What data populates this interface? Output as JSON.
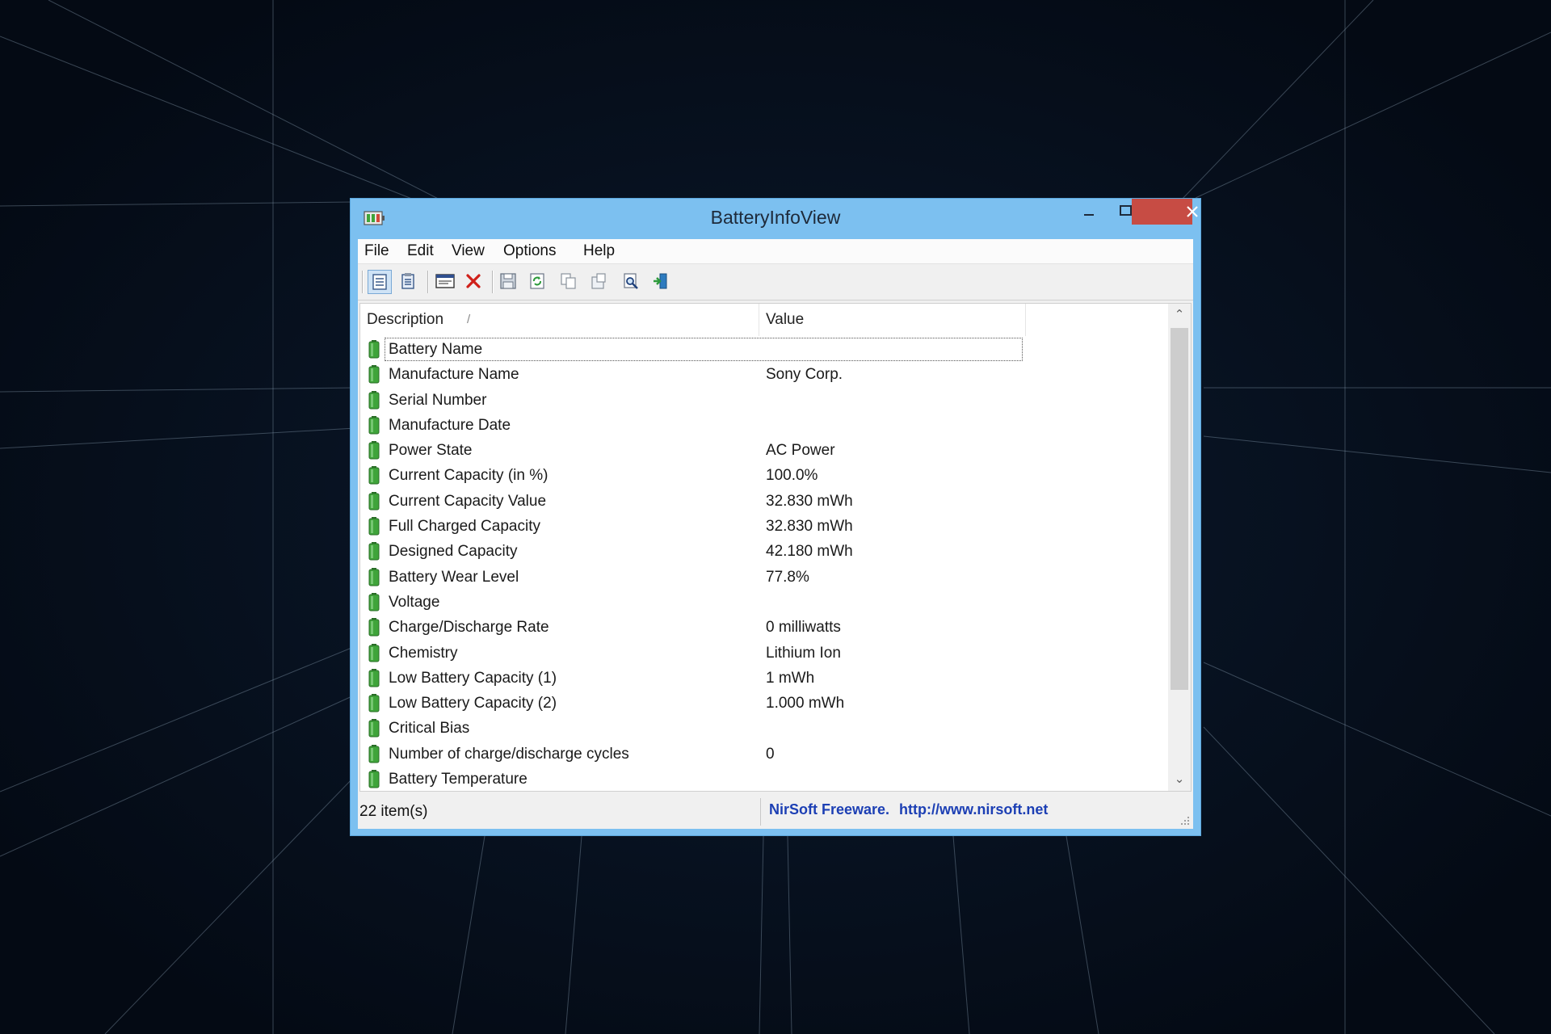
{
  "window": {
    "title": "BatteryInfoView",
    "controls": {
      "minimize": "–",
      "maximize": "□",
      "close": "✕"
    }
  },
  "menu": [
    "File",
    "Edit",
    "View",
    "Options",
    "Help"
  ],
  "toolbar": {
    "icons": [
      "general-mode-icon",
      "properties-icon",
      "html-report-icon",
      "delete-icon",
      "save-icon",
      "refresh-icon",
      "copy-icon",
      "properties-window-icon",
      "find-icon",
      "exit-icon"
    ]
  },
  "table": {
    "columns": [
      "Description",
      "Value"
    ],
    "sort_indicator": "/",
    "rows": [
      {
        "description": "Battery Name",
        "value": ""
      },
      {
        "description": "Manufacture Name",
        "value": "Sony Corp."
      },
      {
        "description": "Serial Number",
        "value": ""
      },
      {
        "description": "Manufacture Date",
        "value": ""
      },
      {
        "description": "Power State",
        "value": "AC Power"
      },
      {
        "description": "Current Capacity (in %)",
        "value": "100.0%"
      },
      {
        "description": "Current Capacity Value",
        "value": "32.830 mWh"
      },
      {
        "description": "Full Charged Capacity",
        "value": "32.830 mWh"
      },
      {
        "description": "Designed Capacity",
        "value": "42.180 mWh"
      },
      {
        "description": "Battery Wear Level",
        "value": "77.8%"
      },
      {
        "description": "Voltage",
        "value": ""
      },
      {
        "description": "Charge/Discharge Rate",
        "value": "0 milliwatts"
      },
      {
        "description": "Chemistry",
        "value": "Lithium Ion"
      },
      {
        "description": "Low Battery Capacity (1)",
        "value": "1 mWh"
      },
      {
        "description": "Low Battery Capacity (2)",
        "value": "1.000 mWh"
      },
      {
        "description": "Critical Bias",
        "value": ""
      },
      {
        "description": "Number of charge/discharge cycles",
        "value": "0"
      },
      {
        "description": "Battery Temperature",
        "value": ""
      }
    ]
  },
  "scrollbar": {
    "up": "⌃",
    "down": "⌄"
  },
  "status": {
    "count": "22 item(s)",
    "credit": "NirSoft Freeware.",
    "link": "http://www.nirsoft.net"
  },
  "colors": {
    "frame": "#7cc0f0",
    "close_button": "#c74c44",
    "link": "#1c3fb4",
    "battery_icon": "#3fa43a",
    "background": "#06101e"
  }
}
